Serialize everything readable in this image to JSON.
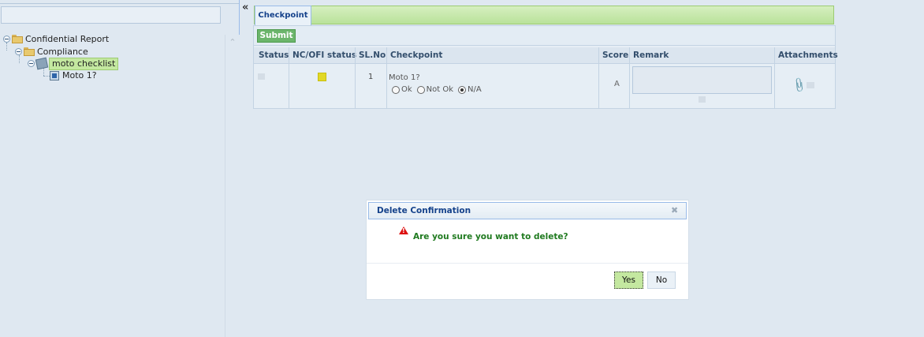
{
  "tree": {
    "root": "Confidential Report",
    "folder": "Compliance",
    "checklist": "moto checklist",
    "item": "Moto 1?"
  },
  "collapse_glyph": "«",
  "tabs": {
    "checkpoint": "Checkpoint"
  },
  "toolbar": {
    "submit": "Submit"
  },
  "grid": {
    "columns": [
      "Status",
      "NC/OFI status",
      "SL.No",
      "Checkpoint",
      "Score",
      "Remark",
      "Attachments"
    ],
    "row": {
      "sl_no": "1",
      "checkpoint": "Moto 1?",
      "options": [
        "Ok",
        "Not Ok",
        "N/A"
      ],
      "selected_option": "N/A",
      "score": "A",
      "nc_status_color": "#e2d827"
    }
  },
  "dialog": {
    "title": "Delete Confirmation",
    "message": "Are you sure you want to delete?",
    "yes": "Yes",
    "no": "No"
  }
}
